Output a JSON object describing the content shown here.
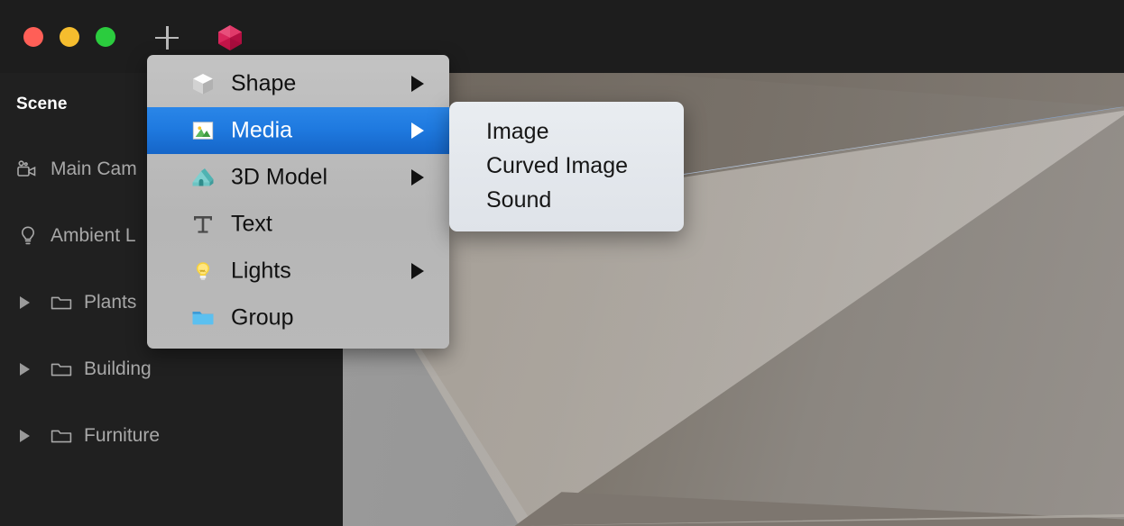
{
  "window": {
    "traffic_lights": [
      {
        "name": "close",
        "color": "#ff5f57"
      },
      {
        "name": "minimize",
        "color": "#f5bd2e"
      },
      {
        "name": "zoom",
        "color": "#2bcc3e"
      }
    ],
    "toolbar": [
      {
        "name": "add-object-button",
        "icon": "plus-icon",
        "label": "+"
      },
      {
        "name": "object-library-button",
        "icon": "polyhedron-icon",
        "label": "",
        "color": "#d61f53"
      }
    ]
  },
  "sidebar": {
    "title": "Scene",
    "items": [
      {
        "label": "Main Cam",
        "icon": "camera-icon",
        "level": 0,
        "disclosure": false
      },
      {
        "label": "Ambient L",
        "icon": "light-icon",
        "level": 0,
        "disclosure": false
      },
      {
        "label": "Plants",
        "icon": "folder-outline-icon",
        "level": 1,
        "disclosure": true
      },
      {
        "label": "Building",
        "icon": "folder-outline-icon",
        "level": 1,
        "disclosure": true
      },
      {
        "label": "Furniture",
        "icon": "folder-outline-icon",
        "level": 1,
        "disclosure": true
      }
    ]
  },
  "context_menu": {
    "highlight_color": "#1f7ae0",
    "items": [
      {
        "label": "Shape",
        "icon": "cube-icon",
        "submenu": true,
        "selected": false
      },
      {
        "label": "Media",
        "icon": "photo-icon",
        "submenu": true,
        "selected": true
      },
      {
        "label": "3D Model",
        "icon": "house-icon",
        "submenu": true,
        "selected": false
      },
      {
        "label": "Text",
        "icon": "text-icon",
        "submenu": false,
        "selected": false
      },
      {
        "label": "Lights",
        "icon": "bulb-icon",
        "submenu": true,
        "selected": false
      },
      {
        "label": "Group",
        "icon": "folder-icon",
        "submenu": false,
        "selected": false
      }
    ]
  },
  "submenu": {
    "parent": "Media",
    "items": [
      {
        "label": "Image"
      },
      {
        "label": "Curved Image"
      },
      {
        "label": "Sound"
      }
    ]
  },
  "viewport": {
    "name": "3d-scene-viewport",
    "sky_top_color": "#7796c6",
    "sky_bottom_color": "#dde3ec",
    "floor_color": "#949494",
    "wall_color": "#7b746b"
  }
}
